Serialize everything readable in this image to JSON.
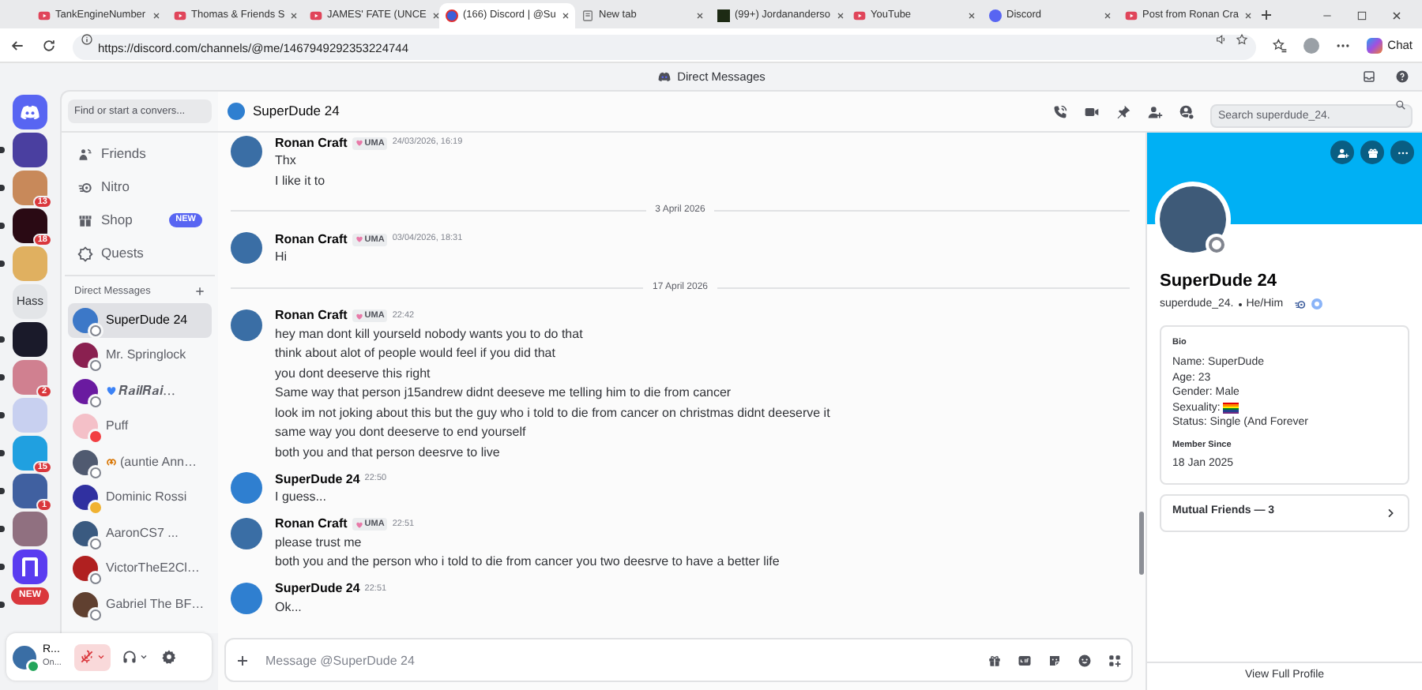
{
  "browser": {
    "tabs": [
      {
        "label": "TankEngineNumber",
        "kind": "video",
        "selected": false
      },
      {
        "label": "Thomas & Friends S",
        "kind": "video",
        "selected": false
      },
      {
        "label": "JAMES' FATE (UNCE",
        "kind": "video",
        "selected": false
      },
      {
        "label": "(166) Discord | @Su",
        "kind": "discord",
        "selected": true
      },
      {
        "label": "New tab",
        "kind": "blank",
        "selected": false
      },
      {
        "label": "(99+) Jordananderso",
        "kind": "image",
        "selected": false
      },
      {
        "label": "YouTube",
        "kind": "video",
        "selected": false
      },
      {
        "label": "Discord",
        "kind": "logo",
        "selected": false
      },
      {
        "label": "Post from Ronan Cra",
        "kind": "video",
        "selected": false
      }
    ],
    "address": "https://discord.com/channels/@me/1467949292353224744",
    "chat_button": "Chat"
  },
  "title_bar": {
    "title": "Direct Messages"
  },
  "servers": [
    {
      "kind": "image",
      "color": "#4a3fa0",
      "unread": true
    },
    {
      "kind": "image",
      "color": "#c8895a",
      "badge": "13",
      "unread": true
    },
    {
      "kind": "image",
      "color": "#2a0a14",
      "badge": "18",
      "unread": true
    },
    {
      "kind": "image",
      "color": "#e0b060",
      "unread": true
    },
    {
      "kind": "text",
      "label": "Hass",
      "unread": false
    },
    {
      "kind": "image",
      "color": "#1a1a2a",
      "unread": true
    },
    {
      "kind": "image",
      "color": "#d08090",
      "badge": "2",
      "unread": true
    },
    {
      "kind": "image",
      "color": "#c8d0f0",
      "unread": true
    },
    {
      "kind": "image",
      "color": "#20a0e0",
      "badge": "15",
      "unread": true
    },
    {
      "kind": "image",
      "color": "#4060a0",
      "badge": "1",
      "unread": true
    },
    {
      "kind": "image",
      "color": "#907080",
      "unread": true
    },
    {
      "kind": "logo",
      "color": "#5a3cf0",
      "unread": true
    },
    {
      "kind": "new",
      "label": "NEW",
      "unread": true
    }
  ],
  "sidebar": {
    "search": "Find or start a convers...",
    "nav": [
      {
        "label": "Friends"
      },
      {
        "label": "Nitro"
      },
      {
        "label": "Shop",
        "badge": "NEW"
      },
      {
        "label": "Quests"
      }
    ],
    "dm_header": "Direct Messages",
    "dms": [
      {
        "name": "SuperDude 24",
        "kind": "plain",
        "presence": {
          "color": "#80848e"
        },
        "selected": true,
        "color": "#3c78c8"
      },
      {
        "name": "Mr. Springlock",
        "kind": "plain",
        "presence": {
          "color": "#80848e"
        },
        "selected": false,
        "color": "#8a2050"
      },
      {
        "name": "𝑹𝒂𝒊𝒍𝑹𝒂𝒊…",
        "kind": "heart",
        "presence": {
          "color": "#80848e"
        },
        "selected": false,
        "color": "#6a1aa0"
      },
      {
        "name": "Puff",
        "kind": "plain",
        "presence": {
          "color": "#f23f43"
        },
        "selected": false,
        "color": "#f4c0c8"
      },
      {
        "name": "(auntie Ann…",
        "kind": "pretzel",
        "presence": {
          "color": "#80848e"
        },
        "selected": false,
        "color": "#505a70"
      },
      {
        "name": "Dominic Rossi",
        "kind": "plain",
        "presence": {
          "color": "#f0b232"
        },
        "selected": false,
        "color": "#3030a0"
      },
      {
        "name": "AaronCS7 ...",
        "kind": "plain",
        "presence": {
          "color": "#80848e"
        },
        "selected": false,
        "color": "#3a5a80"
      },
      {
        "name": "VictorTheE2Cl…",
        "kind": "plain",
        "presence": {
          "color": "#80848e"
        },
        "selected": false,
        "color": "#b02020"
      },
      {
        "name": "Gabriel The BF…",
        "kind": "plain",
        "presence": {
          "color": "#80848e"
        },
        "selected": false,
        "color": "#604030"
      }
    ],
    "user": {
      "name": "R...",
      "status": "On...",
      "presence": {
        "color": "#23a55a"
      },
      "muted": true
    }
  },
  "chat": {
    "title": "SuperDude 24",
    "search": {
      "placeholder": "Search superdude_24."
    },
    "messages": [
      {
        "kind": "group",
        "author": "Ronan Craft",
        "tag": "UMA",
        "time": "24/03/2026, 16:19",
        "color": "#3a6ea5",
        "lines": [
          "Thx",
          "I like it to"
        ]
      },
      {
        "kind": "divider",
        "label": "3 April 2026"
      },
      {
        "kind": "group",
        "author": "Ronan Craft",
        "tag": "UMA",
        "time": "03/04/2026, 18:31",
        "color": "#3a6ea5",
        "lines": [
          "Hi"
        ]
      },
      {
        "kind": "divider",
        "label": "17 April 2026"
      },
      {
        "kind": "group",
        "author": "Ronan Craft",
        "tag": "UMA",
        "time": "22:42",
        "color": "#3a6ea5",
        "lines": [
          "hey man dont kill yourseld nobody wants you to do that",
          "think about alot of people would feel if you did that",
          "you dont deeserve this right",
          "Same way that person j15andrew didnt deeseve me telling him to die from cancer",
          "look im not joking about this but the guy who i told to die from cancer on christmas didnt deeserve it",
          "same way you dont deeserve to end yourself",
          "both you and that person deesrve to live"
        ]
      },
      {
        "kind": "group",
        "author": "SuperDude 24",
        "time": "22:50",
        "color": "#2f7fd0",
        "lines": [
          "I guess..."
        ]
      },
      {
        "kind": "group",
        "author": "Ronan Craft",
        "tag": "UMA",
        "time": "22:51",
        "color": "#3a6ea5",
        "lines": [
          "please trust me",
          "both you and the person who i told to die from cancer you two deesrve to have a better life"
        ]
      },
      {
        "kind": "group",
        "author": "SuperDude 24",
        "time": "22:51",
        "color": "#2f7fd0",
        "lines": [
          "Ok..."
        ]
      }
    ],
    "composer": {
      "placeholder": "Message @SuperDude 24"
    }
  },
  "profile": {
    "name": "SuperDude 24",
    "username": "superdude_24.",
    "pronouns": "He/Him",
    "presence": {
      "color": "#80848e"
    },
    "bio_label": "Bio",
    "bio": [
      {
        "kind": "text",
        "text": "Name: SuperDude"
      },
      {
        "kind": "text",
        "text": "Age: 23"
      },
      {
        "kind": "text",
        "text": "Gender: Male"
      },
      {
        "kind": "flag",
        "text": "Sexuality:"
      },
      {
        "kind": "text",
        "text": "Status: Single (And Forever"
      }
    ],
    "member_since_label": "Member Since",
    "member_since": "18 Jan 2025",
    "mutual": "Mutual Friends — 3",
    "footer": "View Full Profile"
  }
}
